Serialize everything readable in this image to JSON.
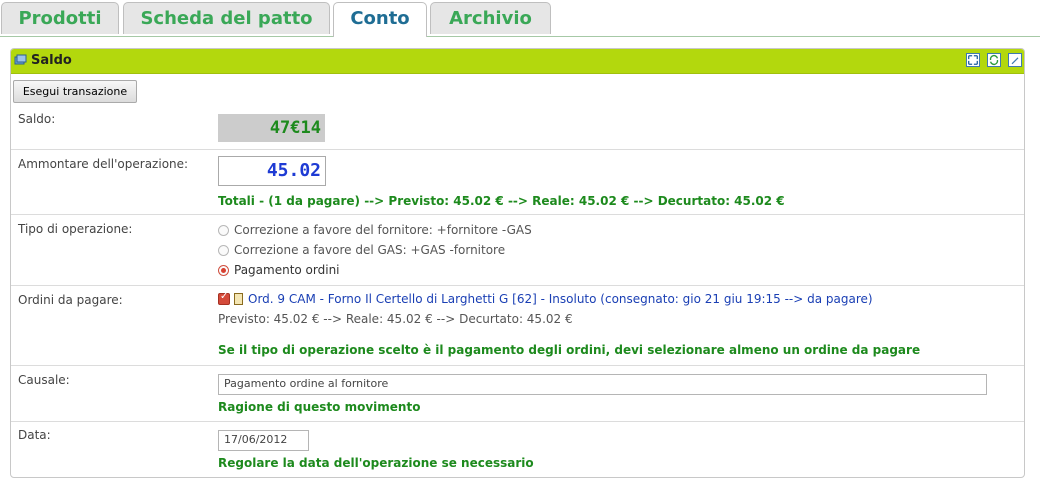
{
  "tabs": [
    {
      "label": "Prodotti",
      "active": false
    },
    {
      "label": "Scheda del patto",
      "active": false
    },
    {
      "label": "Conto",
      "active": true
    },
    {
      "label": "Archivio",
      "active": false
    }
  ],
  "panel": {
    "title": "Saldo",
    "title_icon": "money-icon",
    "header_icons": [
      "maximize-icon",
      "refresh-icon",
      "edit-icon"
    ],
    "accent_color": "#b3d80d"
  },
  "execute_button_label": "Esegui transazione",
  "saldo": {
    "label": "Saldo:",
    "value": "47€14"
  },
  "ammontare": {
    "label": "Ammontare dell'operazione:",
    "value": "45.02",
    "totali": "Totali - (1 da pagare) --> Previsto: 45.02 € --> Reale: 45.02 € --> Decurtato: 45.02 €"
  },
  "tipo": {
    "label": "Tipo di operazione:",
    "options": [
      {
        "label": "Correzione a favore del fornitore: +fornitore -GAS",
        "selected": false
      },
      {
        "label": "Correzione a favore del GAS: +GAS -fornitore",
        "selected": false
      },
      {
        "label": "Pagamento ordini",
        "selected": true
      }
    ]
  },
  "ordini": {
    "label": "Ordini da pagare:",
    "order_text": "Ord. 9 CAM - Forno Il Certello di Larghetti G [62] - Insoluto (consegnato: gio 21 giu 19:15 --> da pagare)",
    "order_checked": true,
    "previsto": "Previsto: 45.02 € --> Reale: 45.02 € --> Decurtato: 45.02 €",
    "help": "Se il tipo di operazione scelto è il pagamento degli ordini, devi selezionare almeno un ordine da pagare"
  },
  "causale": {
    "label": "Causale:",
    "value": "Pagamento ordine al fornitore",
    "help": "Ragione di questo movimento"
  },
  "data": {
    "label": "Data:",
    "value": "17/06/2012",
    "help": "Regolare la data dell'operazione se necessario"
  }
}
